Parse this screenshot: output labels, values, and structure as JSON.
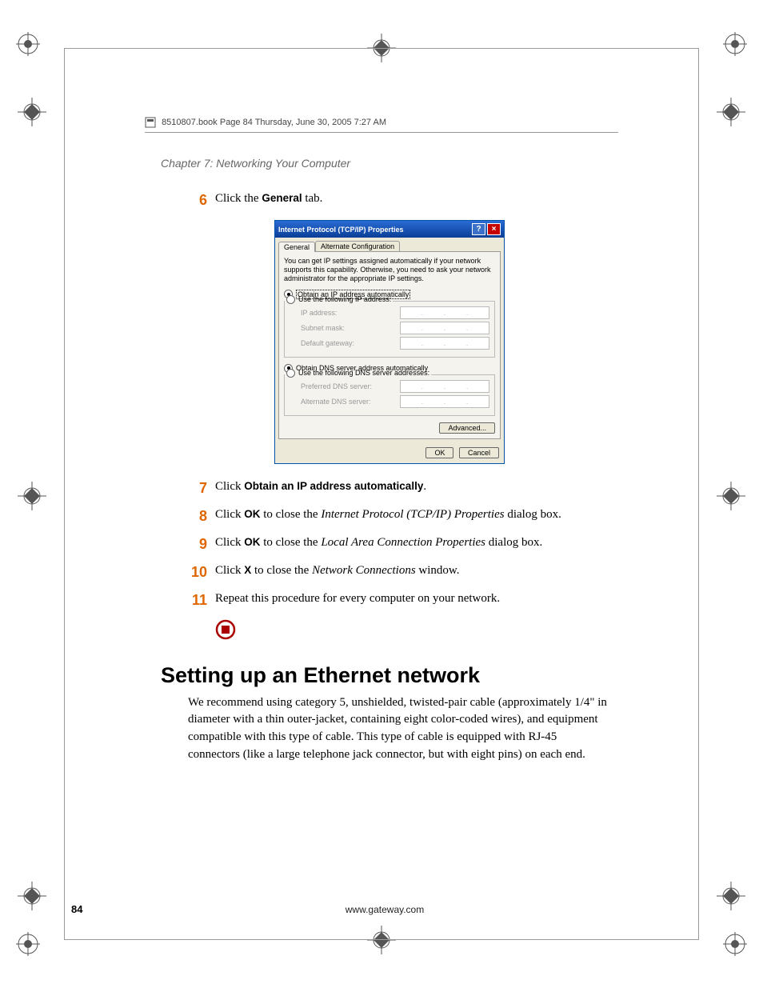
{
  "header": {
    "text": "8510807.book  Page 84  Thursday, June 30, 2005  7:27 AM"
  },
  "chapter_line": "Chapter 7: Networking Your Computer",
  "steps": {
    "s6": {
      "num": "6",
      "pre": "Click the ",
      "bold": "General",
      "post": " tab."
    },
    "s7": {
      "num": "7",
      "pre": "Click ",
      "bold": "Obtain an IP address automatically",
      "post": "."
    },
    "s8": {
      "num": "8",
      "pre": "Click ",
      "bold": "OK",
      "mid": " to close the ",
      "ital": "Internet Protocol (TCP/IP) Properties",
      "post": " dialog box."
    },
    "s9": {
      "num": "9",
      "pre": "Click ",
      "bold": "OK",
      "mid": " to close the ",
      "ital": "Local Area Connection Properties",
      "post": " dialog box."
    },
    "s10": {
      "num": "10",
      "pre": "Click ",
      "bold": "X",
      "mid": " to close the ",
      "ital": "Network Connections",
      "post": " window."
    },
    "s11": {
      "num": "11",
      "text": "Repeat this procedure for every computer on your network."
    }
  },
  "dialog": {
    "title": "Internet Protocol (TCP/IP) Properties",
    "tabs": {
      "t1": "General",
      "t2": "Alternate Configuration"
    },
    "desc": "You can get IP settings assigned automatically if your network supports this capability. Otherwise, you need to ask your network administrator for the appropriate IP settings.",
    "ip_group": {
      "r1": "Obtain an IP address automatically",
      "r2": "Use the following IP address:",
      "f1": "IP address:",
      "f2": "Subnet mask:",
      "f3": "Default gateway:"
    },
    "dns_group": {
      "r1": "Obtain DNS server address automatically",
      "r2": "Use the following DNS server addresses:",
      "f1": "Preferred DNS server:",
      "f2": "Alternate DNS server:"
    },
    "advanced": "Advanced...",
    "ok": "OK",
    "cancel": "Cancel"
  },
  "section": {
    "title": "Setting up an Ethernet network",
    "para": "We recommend using category 5, unshielded, twisted-pair cable (approximately 1/4\" in diameter with a thin outer-jacket, containing eight color-coded wires), and equipment compatible with this type of cable. This type of cable is equipped with RJ-45 connectors (like a large telephone jack connector, but with eight pins) on each end."
  },
  "footer": {
    "page": "84",
    "url": "www.gateway.com"
  }
}
